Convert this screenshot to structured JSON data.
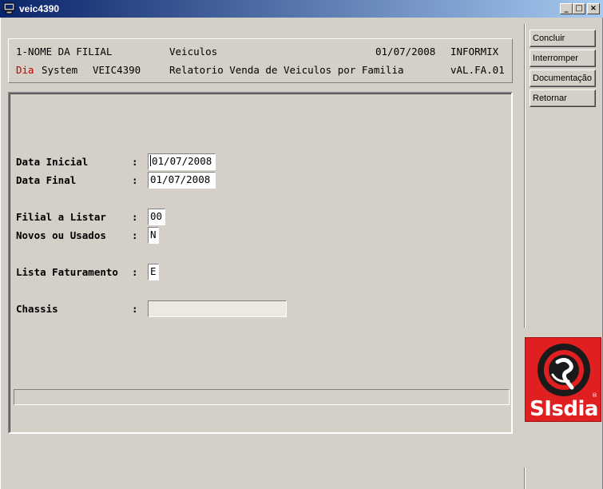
{
  "window": {
    "title": "veic4390",
    "controls": {
      "minimize": "_",
      "maximize": "□",
      "close": "×"
    },
    "icon": "computer-icon"
  },
  "header": {
    "filial": "1-NOME DA FILIAL",
    "module": "Veiculos",
    "date": "01/07/2008",
    "db": "INFORMIX",
    "brand_red": "Dia",
    "brand_rest": "System",
    "program": "VEIC4390",
    "report_title": "Relatorio Venda de Veiculos por Familia",
    "version": "vAL.FA.01",
    "brand_color": "#c00000"
  },
  "form": {
    "colon": ":",
    "data_inicial": {
      "label": "Data Inicial",
      "value": "01/07/2008"
    },
    "data_final": {
      "label": "Data Final",
      "value": "01/07/2008"
    },
    "filial": {
      "label": "Filial a Listar",
      "value": "00"
    },
    "novos_usados": {
      "label": "Novos ou Usados",
      "value": "N"
    },
    "lista_faturamento": {
      "label": "Lista Faturamento",
      "value": "E"
    },
    "chassis": {
      "label": "Chassis",
      "value": ""
    }
  },
  "sidebar": {
    "buttons": [
      "Concluir",
      "Interromper",
      "Documentação",
      "Retornar"
    ]
  },
  "logo": {
    "text": "SIsdia",
    "reg": "®",
    "color": "#e02020"
  }
}
